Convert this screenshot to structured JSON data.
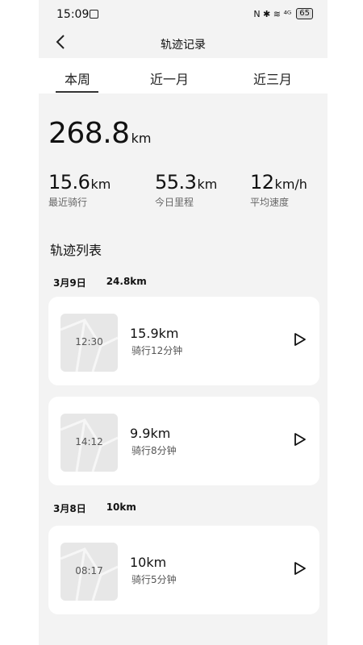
{
  "status": {
    "time": "15:09",
    "battery": "65",
    "icons_text": "N ✱ ≋ ⁴ᴳ"
  },
  "header": {
    "back_icon": "chevron-left-icon",
    "title": "轨迹记录"
  },
  "tabs": [
    {
      "label": "本周",
      "active": true
    },
    {
      "label": "近一月",
      "active": false
    },
    {
      "label": "近三月",
      "active": false
    }
  ],
  "summary": {
    "total_value": "268.8",
    "total_unit": "km",
    "stats": [
      {
        "value": "15.6",
        "unit": "km",
        "label": "最近骑行"
      },
      {
        "value": "55.3",
        "unit": "km",
        "label": "今日里程"
      },
      {
        "value": "12",
        "unit": "km/h",
        "label": "平均速度"
      }
    ]
  },
  "list": {
    "title": "轨迹列表",
    "groups": [
      {
        "date": "3月9日",
        "total": "24.8km",
        "items": [
          {
            "time": "12:30",
            "distance": "15.9km",
            "duration": "骑行12分钟"
          },
          {
            "time": "14:12",
            "distance": "9.9km",
            "duration": "骑行8分钟"
          }
        ]
      },
      {
        "date": "3月8日",
        "total": "10km",
        "items": [
          {
            "time": "08:17",
            "distance": "10km",
            "duration": "骑行5分钟"
          }
        ]
      }
    ]
  },
  "colors": {
    "background": "#f3f3f3",
    "card": "#ffffff",
    "thumb": "#e7e7e7",
    "text": "#111111"
  }
}
